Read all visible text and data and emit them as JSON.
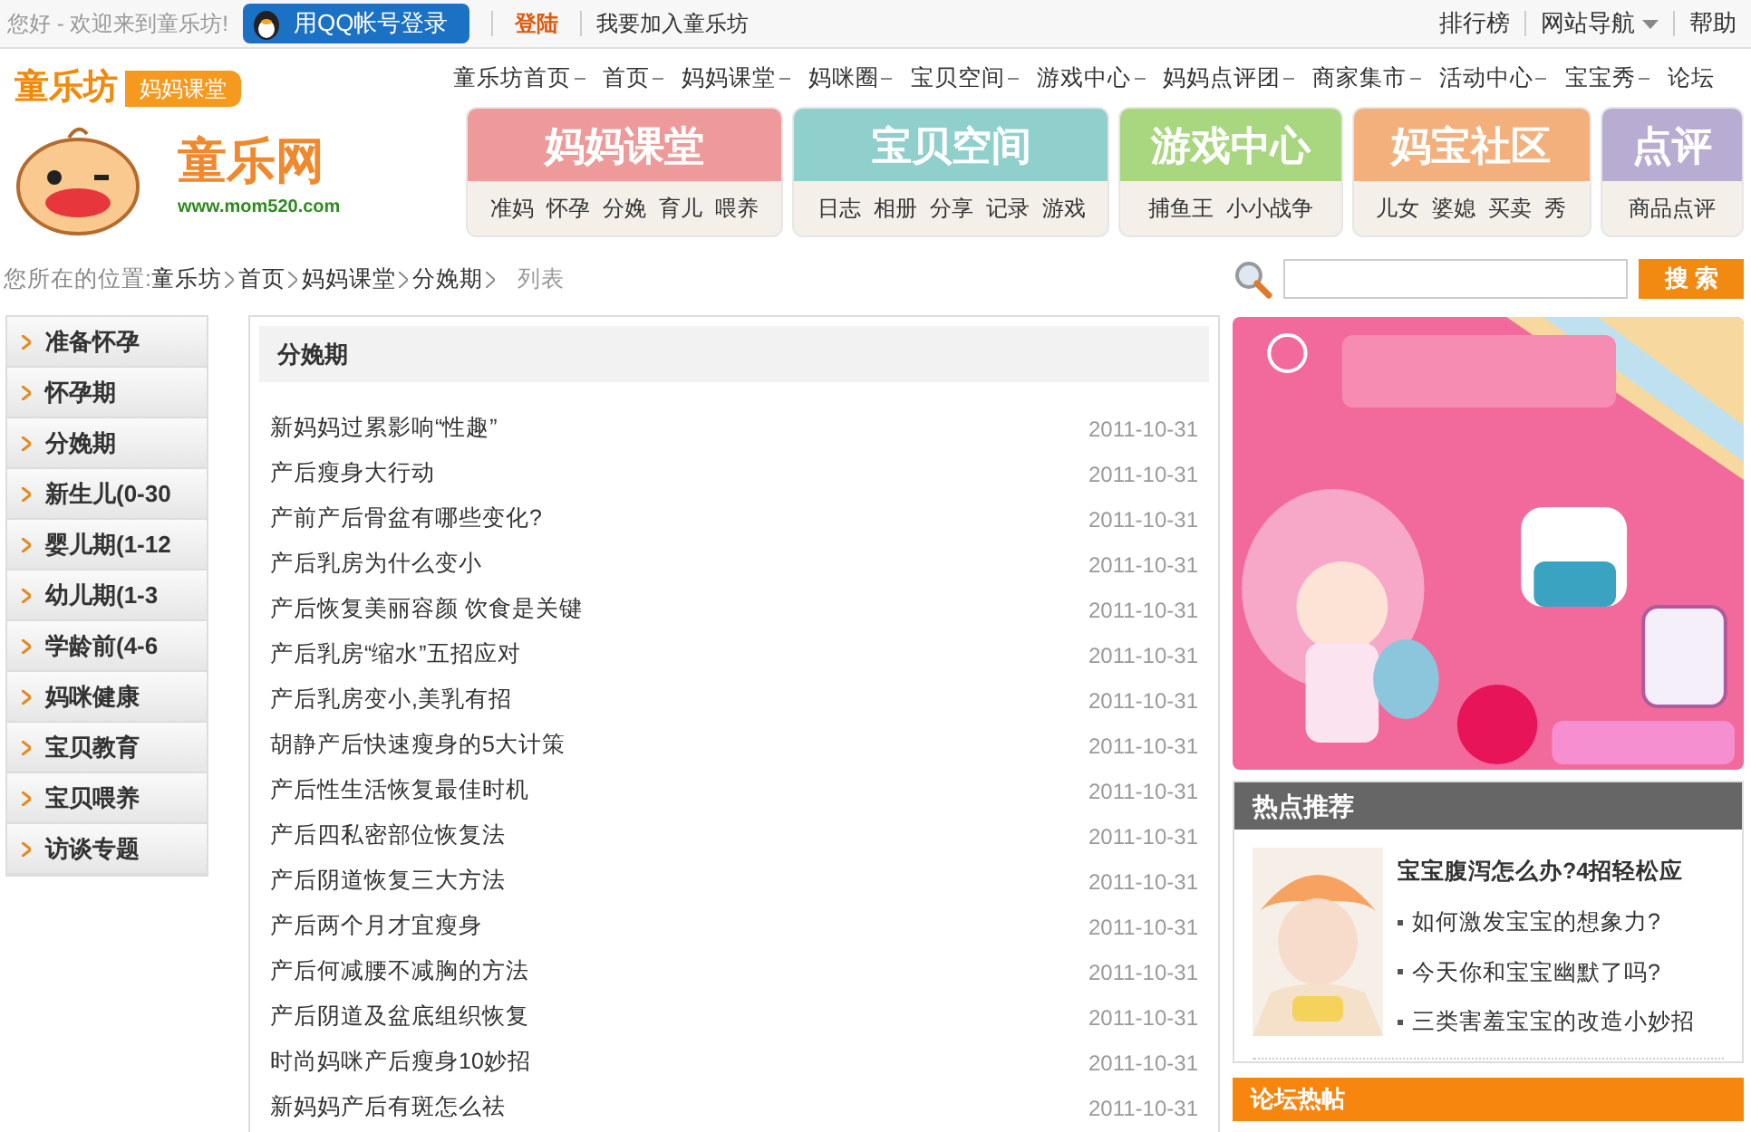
{
  "topbar": {
    "greeting": "您好 - 欢迎来到童乐坊!",
    "qq_login": "用QQ帐号登录",
    "login": "登陆",
    "join": "我要加入童乐坊",
    "right_links": [
      {
        "label": "排行榜",
        "kind": "link"
      },
      {
        "label": "网站导航",
        "kind": "dropdown"
      },
      {
        "label": "帮助",
        "kind": "link"
      }
    ]
  },
  "logo": {
    "brand": "童乐坊",
    "badge": "妈妈课堂",
    "site": "童乐网",
    "url": "www.mom520.com"
  },
  "nav": [
    "童乐坊首页",
    "首页",
    "妈妈课堂",
    "妈咪圈",
    "宝贝空间",
    "游戏中心",
    "妈妈点评团",
    "商家集市",
    "活动中心",
    "宝宝秀",
    "论坛"
  ],
  "channels": [
    {
      "title": "妈妈课堂",
      "color": "#ef9a9a",
      "links": [
        "准妈",
        "怀孕",
        "分娩",
        "育儿",
        "喂养"
      ]
    },
    {
      "title": "宝贝空间",
      "color": "#8fd0cc",
      "links": [
        "日志",
        "相册",
        "分享",
        "记录",
        "游戏"
      ]
    },
    {
      "title": "游戏中心",
      "color": "#a8d77f",
      "links": [
        "捕鱼王",
        "小小战争"
      ]
    },
    {
      "title": "妈宝社区",
      "color": "#f4b07c",
      "links": [
        "儿女",
        "婆媳",
        "买卖",
        "秀"
      ]
    },
    {
      "title": "点评",
      "color": "#b9acd2",
      "links": [
        "商品点评"
      ]
    }
  ],
  "breadcrumb": {
    "label": "您所在的位置:",
    "path": [
      "童乐坊",
      "首页",
      "妈妈课堂",
      "分娩期"
    ],
    "current": "列表"
  },
  "search": {
    "button": "搜 索"
  },
  "sidebar": {
    "items": [
      {
        "label": "准备怀孕",
        "selected": false
      },
      {
        "label": "怀孕期",
        "selected": false
      },
      {
        "label": "分娩期",
        "selected": false
      },
      {
        "label": "新生儿(0-30",
        "selected": false
      },
      {
        "label": "婴儿期(1-12",
        "selected": false
      },
      {
        "label": "幼儿期(1-3",
        "selected": false
      },
      {
        "label": "学龄前(4-6",
        "selected": false
      },
      {
        "label": "妈咪健康",
        "selected": false
      },
      {
        "label": "宝贝教育",
        "selected": false
      },
      {
        "label": "宝贝喂养",
        "selected": false
      },
      {
        "label": "访谈专题",
        "selected": false
      }
    ]
  },
  "list": {
    "title": "分娩期",
    "rows": [
      {
        "title": "新妈妈过累影响“性趣”",
        "date": "2011-10-31"
      },
      {
        "title": "产后瘦身大行动",
        "date": "2011-10-31"
      },
      {
        "title": "产前产后骨盆有哪些变化?",
        "date": "2011-10-31"
      },
      {
        "title": "产后乳房为什么变小",
        "date": "2011-10-31"
      },
      {
        "title": "产后恢复美丽容颜 饮食是关键",
        "date": "2011-10-31"
      },
      {
        "title": "产后乳房“缩水”五招应对",
        "date": "2011-10-31"
      },
      {
        "title": "产后乳房变小,美乳有招",
        "date": "2011-10-31"
      },
      {
        "title": "胡静产后快速瘦身的5大计策",
        "date": "2011-10-31"
      },
      {
        "title": "产后性生活恢复最佳时机",
        "date": "2011-10-31"
      },
      {
        "title": "产后四私密部位恢复法",
        "date": "2011-10-31"
      },
      {
        "title": "产后阴道恢复三大方法",
        "date": "2011-10-31"
      },
      {
        "title": "产后两个月才宜瘦身",
        "date": "2011-10-31"
      },
      {
        "title": "产后何减腰不减胸的方法",
        "date": "2011-10-31"
      },
      {
        "title": "产后阴道及盆底组织恢复",
        "date": "2011-10-31"
      },
      {
        "title": "时尚妈咪产后瘦身10妙招",
        "date": "2011-10-31"
      },
      {
        "title": "新妈妈产后有斑怎么祛",
        "date": "2011-10-31"
      }
    ]
  },
  "hot": {
    "title": "热点推荐",
    "headline": "宝宝腹泻怎么办?4招轻松应",
    "items": [
      "如何激发宝宝的想象力?",
      "今天你和宝宝幽默了吗?",
      "三类害羞宝宝的改造小妙招"
    ]
  },
  "forum": {
    "title": "论坛热帖"
  }
}
